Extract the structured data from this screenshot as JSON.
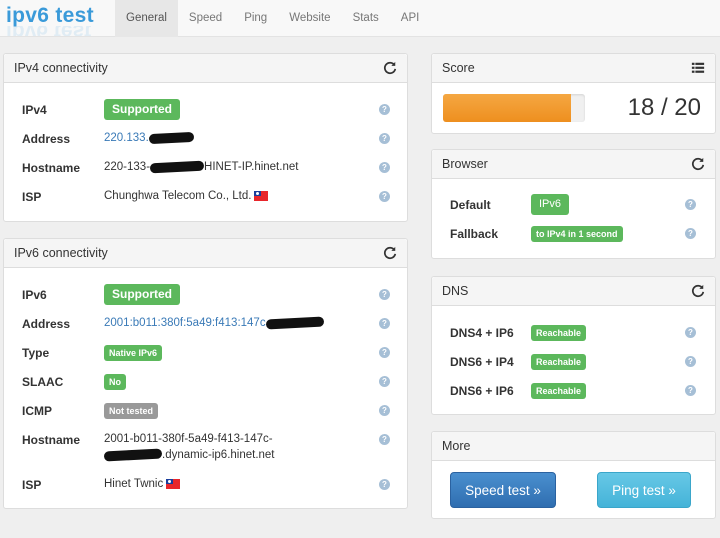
{
  "nav": {
    "brand": "ipv6 test",
    "tabs": [
      "General",
      "Speed",
      "Ping",
      "Website",
      "Stats",
      "API"
    ],
    "active_tab": "General"
  },
  "ipv4": {
    "title": "IPv4 connectivity",
    "rows": {
      "ipv4": {
        "label": "IPv4",
        "badge": "Supported"
      },
      "address": {
        "label": "Address",
        "value": "220.133."
      },
      "hostname": {
        "label": "Hostname",
        "prefix": "220-133-",
        "suffix": "HINET-IP.hinet.net"
      },
      "isp": {
        "label": "ISP",
        "value": "Chunghwa Telecom Co., Ltd."
      }
    }
  },
  "ipv6": {
    "title": "IPv6 connectivity",
    "rows": {
      "ipv6": {
        "label": "IPv6",
        "badge": "Supported"
      },
      "address": {
        "label": "Address",
        "value": "2001:b011:380f:5a49:f413:147c"
      },
      "type": {
        "label": "Type",
        "badge": "Native IPv6"
      },
      "slaac": {
        "label": "SLAAC",
        "badge": "No"
      },
      "icmp": {
        "label": "ICMP",
        "badge": "Not tested"
      },
      "hostname": {
        "label": "Hostname",
        "line1": "2001-b011-380f-5a49-f413-147c-",
        "line2": ".dynamic-ip6.hinet.net"
      },
      "isp": {
        "label": "ISP",
        "value": "Hinet Twnic"
      }
    }
  },
  "score": {
    "title": "Score",
    "value": 18,
    "max": 20,
    "text": "18 / 20",
    "fraction": 0.9
  },
  "browser": {
    "title": "Browser",
    "default": {
      "label": "Default",
      "badge": "IPv6"
    },
    "fallback": {
      "label": "Fallback",
      "badge": "to IPv4 in 1 second"
    }
  },
  "dns": {
    "title": "DNS",
    "rows": [
      {
        "label": "DNS4 + IP6",
        "badge": "Reachable"
      },
      {
        "label": "DNS6 + IP4",
        "badge": "Reachable"
      },
      {
        "label": "DNS6 + IP6",
        "badge": "Reachable"
      }
    ]
  },
  "more": {
    "title": "More",
    "speed_button": "Speed test »",
    "ping_button": "Ping test »"
  },
  "colors": {
    "accent": "#3a9ad9",
    "success": "#5cb85c",
    "muted": "#999999",
    "progress": "#f0a030"
  },
  "icons": {
    "refresh": "refresh-icon",
    "list": "list-icon",
    "help": "help-icon",
    "flag": "taiwan-flag-icon"
  }
}
